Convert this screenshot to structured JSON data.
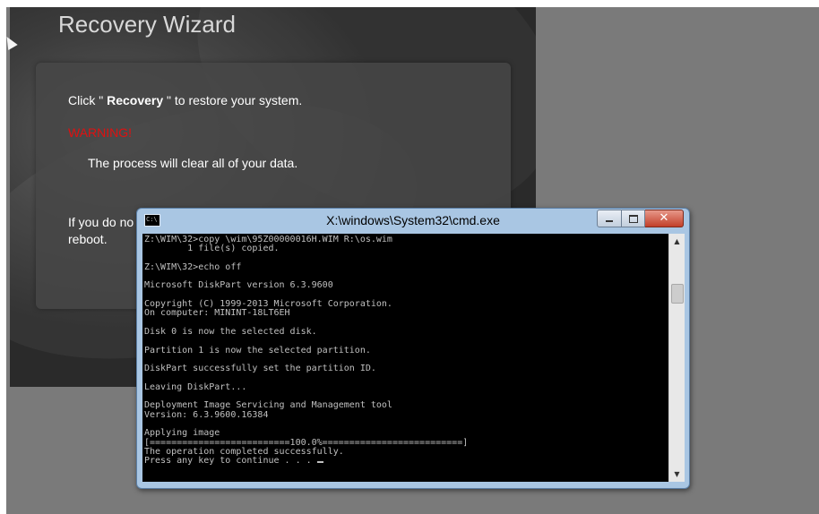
{
  "wizard": {
    "title": "Recovery Wizard",
    "instruction_prefix": "Click \" ",
    "instruction_bold": "Recovery",
    "instruction_suffix": " \" to restore your system.",
    "warning": "WARNING!",
    "warning_detail": "The process will clear all of your data.",
    "partial_line1": "If you do no",
    "partial_line2": "reboot."
  },
  "cmd_window": {
    "title": "X:\\windows\\System32\\cmd.exe",
    "icon_text": "C:\\",
    "lines": [
      "Z:\\WIM\\32>copy \\wim\\95Z00000016H.WIM R:\\os.wim",
      "        1 file(s) copied.",
      "",
      "Z:\\WIM\\32>echo off",
      "",
      "Microsoft DiskPart version 6.3.9600",
      "",
      "Copyright (C) 1999-2013 Microsoft Corporation.",
      "On computer: MININT-18LT6EH",
      "",
      "Disk 0 is now the selected disk.",
      "",
      "Partition 1 is now the selected partition.",
      "",
      "DiskPart successfully set the partition ID.",
      "",
      "Leaving DiskPart...",
      "",
      "Deployment Image Servicing and Management tool",
      "Version: 6.3.9600.16384",
      "",
      "Applying image",
      "[==========================100.0%==========================]",
      "The operation completed successfully.",
      "Press any key to continue . . . "
    ]
  },
  "icons": {
    "cursor": "mouse-cursor-icon",
    "minimize": "minimize-icon",
    "maximize": "maximize-icon",
    "close": "close-icon",
    "close_glyph": "✕",
    "scroll_up_glyph": "▲",
    "scroll_down_glyph": "▼"
  },
  "colors": {
    "warning": "#e01010",
    "console_bg": "#000000",
    "console_text": "#c0c0c0",
    "close_button": "#c2402a"
  }
}
